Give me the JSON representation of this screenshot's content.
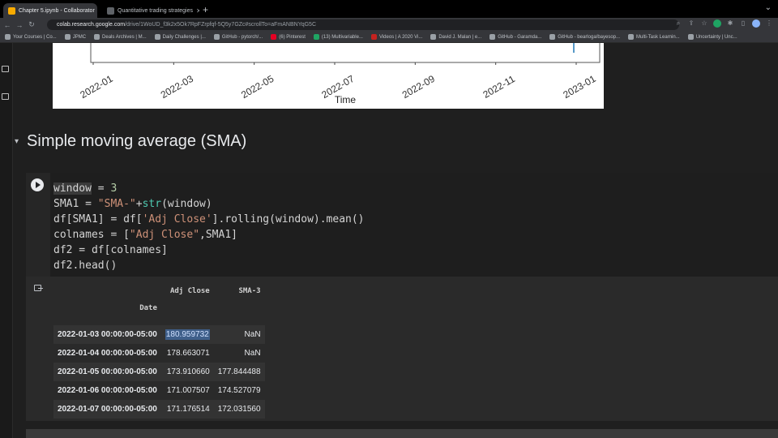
{
  "browser": {
    "tabs": [
      {
        "title": "Chapter 5.ipynb - Collaborator",
        "active": true
      },
      {
        "title": "Quantitative trading strategies",
        "active": false
      }
    ],
    "url": {
      "host": "colab.research.google.com",
      "path": "/drive/1WoUD_f3k2x5Ok7RpFZrpfqf-5Q5y7GZc#scrollTo=aFmANBNYqG5C"
    },
    "bookmarks": [
      "Your Courses | Co...",
      "JPMC",
      "Deals Archives | M...",
      "Daily Challenges |...",
      "GitHub - pytorch/...",
      "(6) Pinterest",
      "(13) Multivariable...",
      "Videos | A 2020 Vi...",
      "David J. Malan | e...",
      "GitHub - Garamda...",
      "GitHub - bearloga/bayesop...",
      "Multi-Task Learnin...",
      "Uncertainty | Unc..."
    ]
  },
  "plot": {
    "xlabel": "Time",
    "xticks": [
      "2022-01",
      "2022-03",
      "2022-05",
      "2022-07",
      "2022-09",
      "2022-11",
      "2023-01"
    ]
  },
  "section": {
    "title": "Simple moving average (SMA)"
  },
  "code": {
    "line1": [
      "window",
      " = ",
      "3"
    ],
    "line2": [
      "SMA1 = ",
      "\"SMA-\"",
      "+",
      "str",
      "(window)"
    ],
    "line3": [
      "df[SMA1] = df[",
      "'Adj Close'",
      "].rolling(window).mean()"
    ],
    "line4": [
      "colnames = [",
      "\"Adj Close\"",
      ",SMA1]"
    ],
    "line5": "df2 = df[colnames]",
    "line6": "df2.head()"
  },
  "table": {
    "columns": [
      "Adj Close",
      "SMA-3"
    ],
    "index_name": "Date",
    "rows": [
      {
        "date": "2022-01-03 00:00:00-05:00",
        "adj_close": "180.959732",
        "sma": "NaN"
      },
      {
        "date": "2022-01-04 00:00:00-05:00",
        "adj_close": "178.663071",
        "sma": "NaN"
      },
      {
        "date": "2022-01-05 00:00:00-05:00",
        "adj_close": "173.910660",
        "sma": "177.844488"
      },
      {
        "date": "2022-01-06 00:00:00-05:00",
        "adj_close": "171.007507",
        "sma": "174.527079"
      },
      {
        "date": "2022-01-07 00:00:00-05:00",
        "adj_close": "171.176514",
        "sma": "172.031560"
      }
    ]
  }
}
